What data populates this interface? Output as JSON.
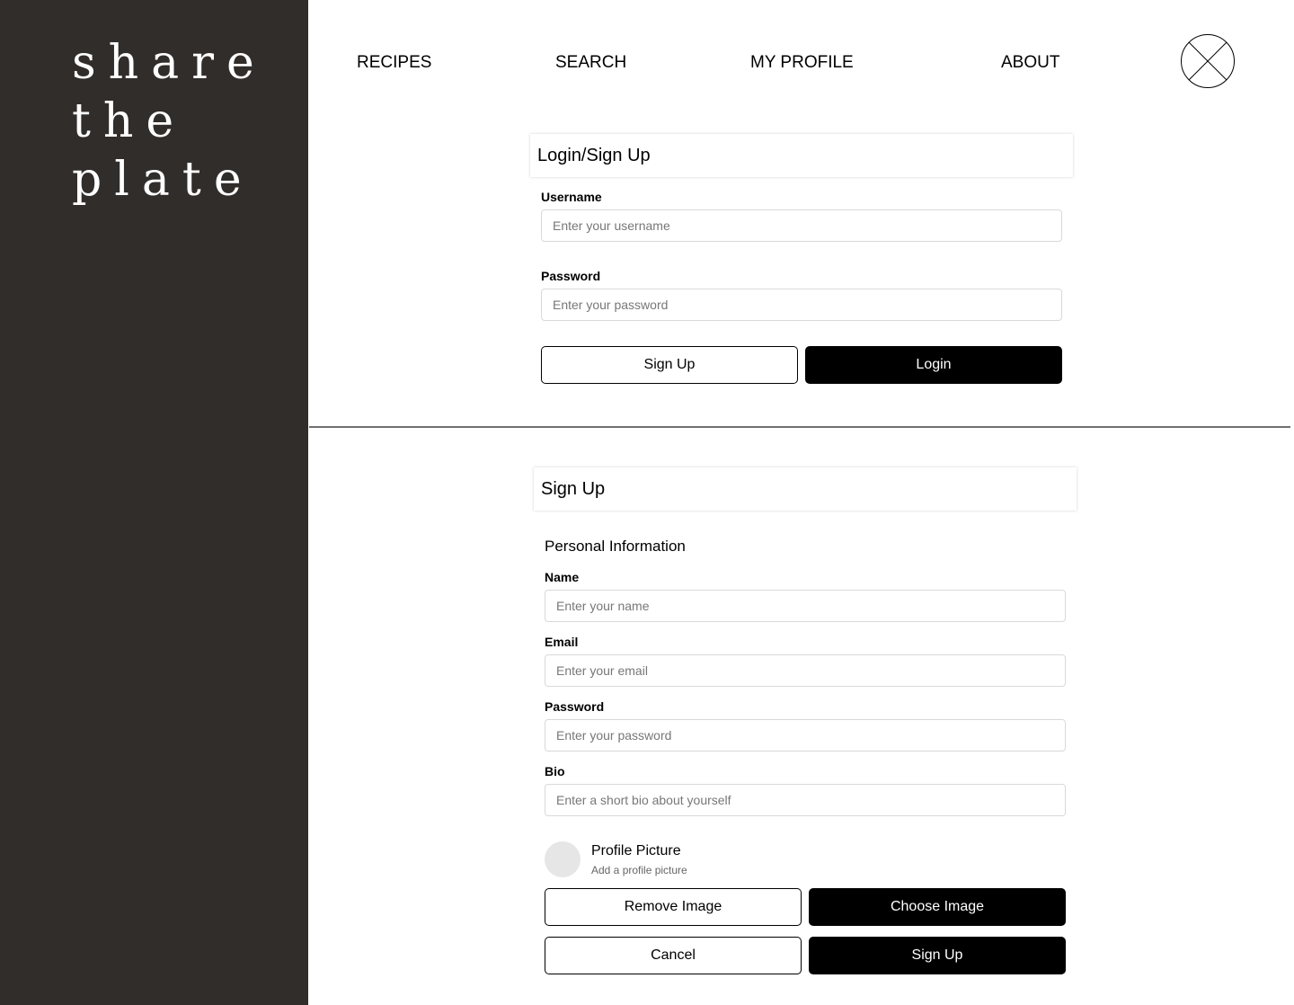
{
  "brand": {
    "line1": "share",
    "line2": "the",
    "line3": "plate"
  },
  "nav": {
    "recipes": "RECIPES",
    "search": "SEARCH",
    "my_profile": "MY PROFILE",
    "about": "ABOUT",
    "avatar_icon": "close-x-circle-icon"
  },
  "login": {
    "title": "Login/Sign Up",
    "username_label": "Username",
    "username_placeholder": "Enter your username",
    "username_value": "",
    "password_label": "Password",
    "password_placeholder": "Enter your password",
    "password_value": "",
    "signup_button": "Sign Up",
    "login_button": "Login"
  },
  "signup": {
    "title": "Sign Up",
    "section_heading": "Personal Information",
    "name_label": "Name",
    "name_placeholder": "Enter your name",
    "email_label": "Email",
    "email_placeholder": "Enter your email",
    "password_label": "Password",
    "password_placeholder": "Enter your password",
    "bio_label": "Bio",
    "bio_placeholder": "Enter a short bio about yourself",
    "profile_picture_title": "Profile Picture",
    "profile_picture_subtitle": "Add a profile picture",
    "remove_image_button": "Remove Image",
    "choose_image_button": "Choose Image",
    "cancel_button": "Cancel",
    "signup_button": "Sign Up"
  },
  "colors": {
    "sidebar": "#312d2b",
    "primary_button": "#000000",
    "background": "#ffffff"
  }
}
